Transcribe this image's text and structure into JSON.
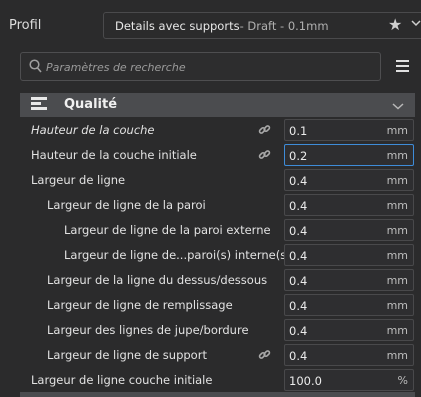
{
  "profile": {
    "label": "Profil",
    "name": "Details avec supports",
    "sub": " - Draft - 0.1mm"
  },
  "search": {
    "placeholder": "Paramètres de recherche"
  },
  "category": {
    "title": "Qualité"
  },
  "settings": [
    {
      "label": "Hauteur de la couche",
      "value": "0.1",
      "unit": "mm",
      "italic": true,
      "indent": 31,
      "link": true,
      "focused": false
    },
    {
      "label": "Hauteur de la couche initiale",
      "value": "0.2",
      "unit": "mm",
      "italic": false,
      "indent": 31,
      "link": true,
      "focused": true
    },
    {
      "label": "Largeur de ligne",
      "value": "0.4",
      "unit": "mm",
      "italic": false,
      "indent": 31,
      "link": false,
      "focused": false
    },
    {
      "label": "Largeur de ligne de la paroi",
      "value": "0.4",
      "unit": "mm",
      "italic": false,
      "indent": 47,
      "link": false,
      "focused": false
    },
    {
      "label": "Largeur de ligne de la paroi externe",
      "value": "0.4",
      "unit": "mm",
      "italic": false,
      "indent": 64,
      "link": false,
      "focused": false
    },
    {
      "label": "Largeur de ligne de...paroi(s) interne(s)",
      "value": "0.4",
      "unit": "mm",
      "italic": false,
      "indent": 64,
      "link": false,
      "focused": false
    },
    {
      "label": "Largeur de la ligne du dessus/dessous",
      "value": "0.4",
      "unit": "mm",
      "italic": false,
      "indent": 47,
      "link": false,
      "focused": false
    },
    {
      "label": "Largeur de ligne de remplissage",
      "value": "0.4",
      "unit": "mm",
      "italic": false,
      "indent": 47,
      "link": false,
      "focused": false
    },
    {
      "label": "Largeur des lignes de jupe/bordure",
      "value": "0.4",
      "unit": "mm",
      "italic": false,
      "indent": 47,
      "link": false,
      "focused": false
    },
    {
      "label": "Largeur de ligne de support",
      "value": "0.4",
      "unit": "mm",
      "italic": false,
      "indent": 47,
      "link": true,
      "focused": false
    },
    {
      "label": "Largeur de ligne couche initiale",
      "value": "100.0",
      "unit": "%",
      "italic": false,
      "indent": 31,
      "link": false,
      "focused": false
    }
  ]
}
